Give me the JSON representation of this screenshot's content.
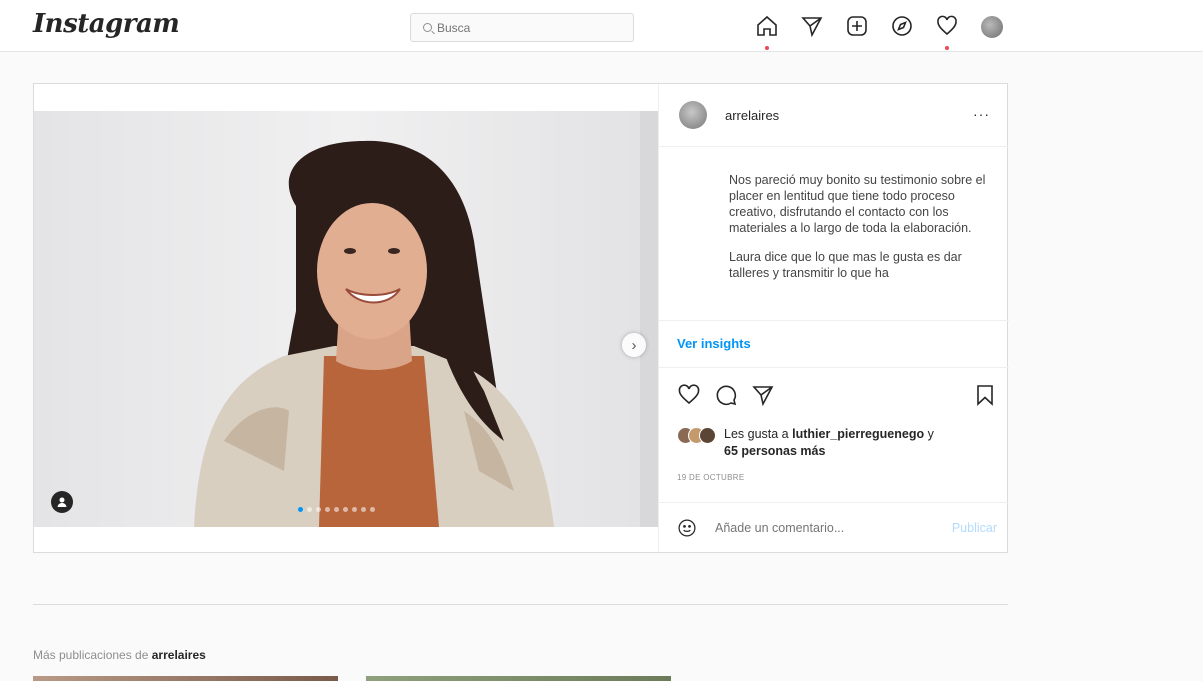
{
  "nav": {
    "logo": "Instagram",
    "search_placeholder": "Busca",
    "icons": [
      "home-icon",
      "direct-icon",
      "new-post-icon",
      "explore-icon",
      "activity-icon",
      "profile-avatar"
    ]
  },
  "post": {
    "username": "arrelaires",
    "more_label": "···",
    "caption_paragraphs": [
      "Nos pareció muy bonito su testimonio sobre el placer en lentitud que tiene todo proceso creativo, disfrutando el contacto con los materiales a lo largo de toda la elaboración.",
      "Laura dice que lo que mas le gusta es dar talleres y transmitir lo que ha"
    ],
    "insights_label": "Ver insights",
    "likes_prefix": "Les gusta a",
    "likes_user": "luthier_pierreguenego",
    "likes_middle": "y",
    "likes_others": "65 personas más",
    "date": "19 DE OCTUBRE",
    "comment_placeholder": "Añade un comentario...",
    "publish_label": "Publicar",
    "carousel_count": 9,
    "carousel_active": 1
  },
  "more_posts": {
    "prefix": "Más publicaciones de",
    "username": "arrelaires"
  },
  "colors": {
    "accent": "#0095f6",
    "notification": "#ed4956",
    "publish_disabled": "#b3dbff"
  }
}
